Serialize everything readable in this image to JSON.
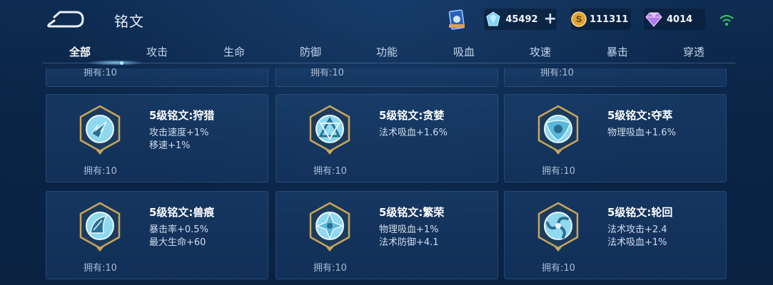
{
  "header": {
    "title": "铭文",
    "resources": {
      "diamonds": "45492",
      "gold": "111311",
      "gems": "4014"
    }
  },
  "tabs": [
    "全部",
    "攻击",
    "生命",
    "防御",
    "功能",
    "吸血",
    "攻速",
    "暴击",
    "穿透"
  ],
  "active_tab": "全部",
  "partial_row": [
    "拥有:10",
    "拥有:10",
    "拥有:10"
  ],
  "inscriptions": [
    {
      "name": "5级铭文:狩猎",
      "attrs": [
        "攻击速度+1%",
        "移速+1%"
      ],
      "owned": "拥有:10",
      "icon": "hunt-emblem-icon"
    },
    {
      "name": "5级铭文:贪婪",
      "attrs": [
        "法术吸血+1.6%"
      ],
      "owned": "拥有:10",
      "icon": "greed-emblem-icon"
    },
    {
      "name": "5级铭文:夺萃",
      "attrs": [
        "物理吸血+1.6%"
      ],
      "owned": "拥有:10",
      "icon": "seize-emblem-icon"
    },
    {
      "name": "5级铭文:兽痕",
      "attrs": [
        "暴击率+0.5%",
        "最大生命+60"
      ],
      "owned": "拥有:10",
      "icon": "beast-emblem-icon"
    },
    {
      "name": "5级铭文:繁荣",
      "attrs": [
        "物理吸血+1%",
        "法术防御+4.1"
      ],
      "owned": "拥有:10",
      "icon": "prosper-emblem-icon"
    },
    {
      "name": "5级铭文:轮回",
      "attrs": [
        "法术攻击+2.4",
        "法术吸血+1%"
      ],
      "owned": "拥有:10",
      "icon": "cycle-emblem-icon"
    }
  ],
  "colors": {
    "accent": "#8fd8f0",
    "gold_frame": "#c9a55a",
    "bg": "#0b2547"
  }
}
